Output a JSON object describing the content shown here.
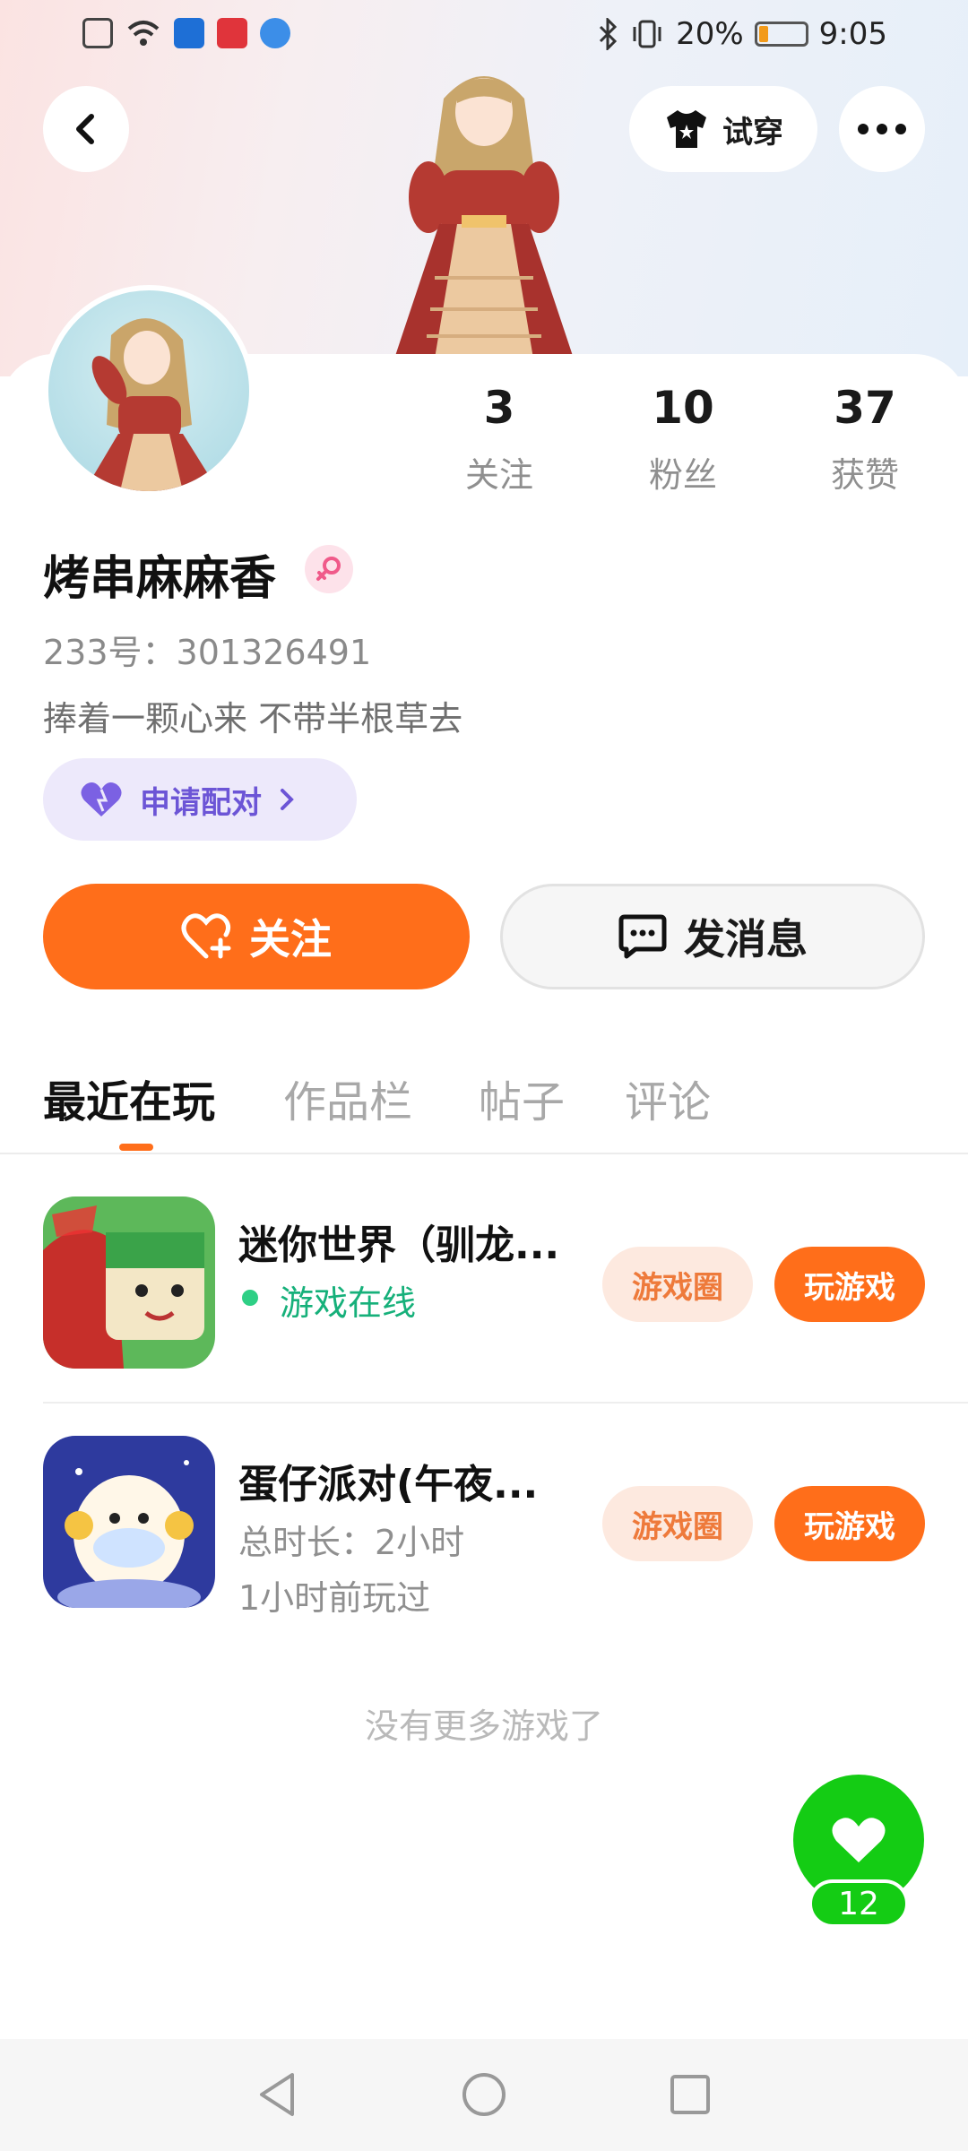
{
  "status_bar": {
    "battery": "20%",
    "battery_level": 0.2,
    "time": "9:05"
  },
  "header": {
    "back_icon": "chevron-left-icon",
    "try_on_label": "试穿",
    "more_icon": "more-dots-icon"
  },
  "profile": {
    "stats": [
      {
        "value": "3",
        "label": "关注"
      },
      {
        "value": "10",
        "label": "粉丝"
      },
      {
        "value": "37",
        "label": "获赞"
      }
    ],
    "name": "烤串麻麻香",
    "gender": "female",
    "uid": "233号：301326491",
    "bio": "捧着一颗心来 不带半根草去",
    "pair_label": "申请配对"
  },
  "actions": {
    "follow_label": "关注",
    "message_label": "发消息"
  },
  "tabs": [
    {
      "label": "最近在玩",
      "active": true
    },
    {
      "label": "作品栏",
      "active": false
    },
    {
      "label": "帖子",
      "active": false
    },
    {
      "label": "评论",
      "active": false
    }
  ],
  "games": [
    {
      "title": "迷你世界（驯龙...",
      "line1": "游戏在线",
      "line2": "",
      "circle_label": "游戏圈",
      "play_label": "玩游戏"
    },
    {
      "title": "蛋仔派对(午夜...",
      "line1": "总时长：2小时",
      "line2": "1小时前玩过",
      "circle_label": "游戏圈",
      "play_label": "玩游戏"
    }
  ],
  "list_end": "没有更多游戏了",
  "like": {
    "count": "12"
  },
  "colors": {
    "accent": "#ff6e1a",
    "like_green": "#14cc14",
    "pair_purple": "#6c55d6",
    "online_green": "#16b07a"
  }
}
